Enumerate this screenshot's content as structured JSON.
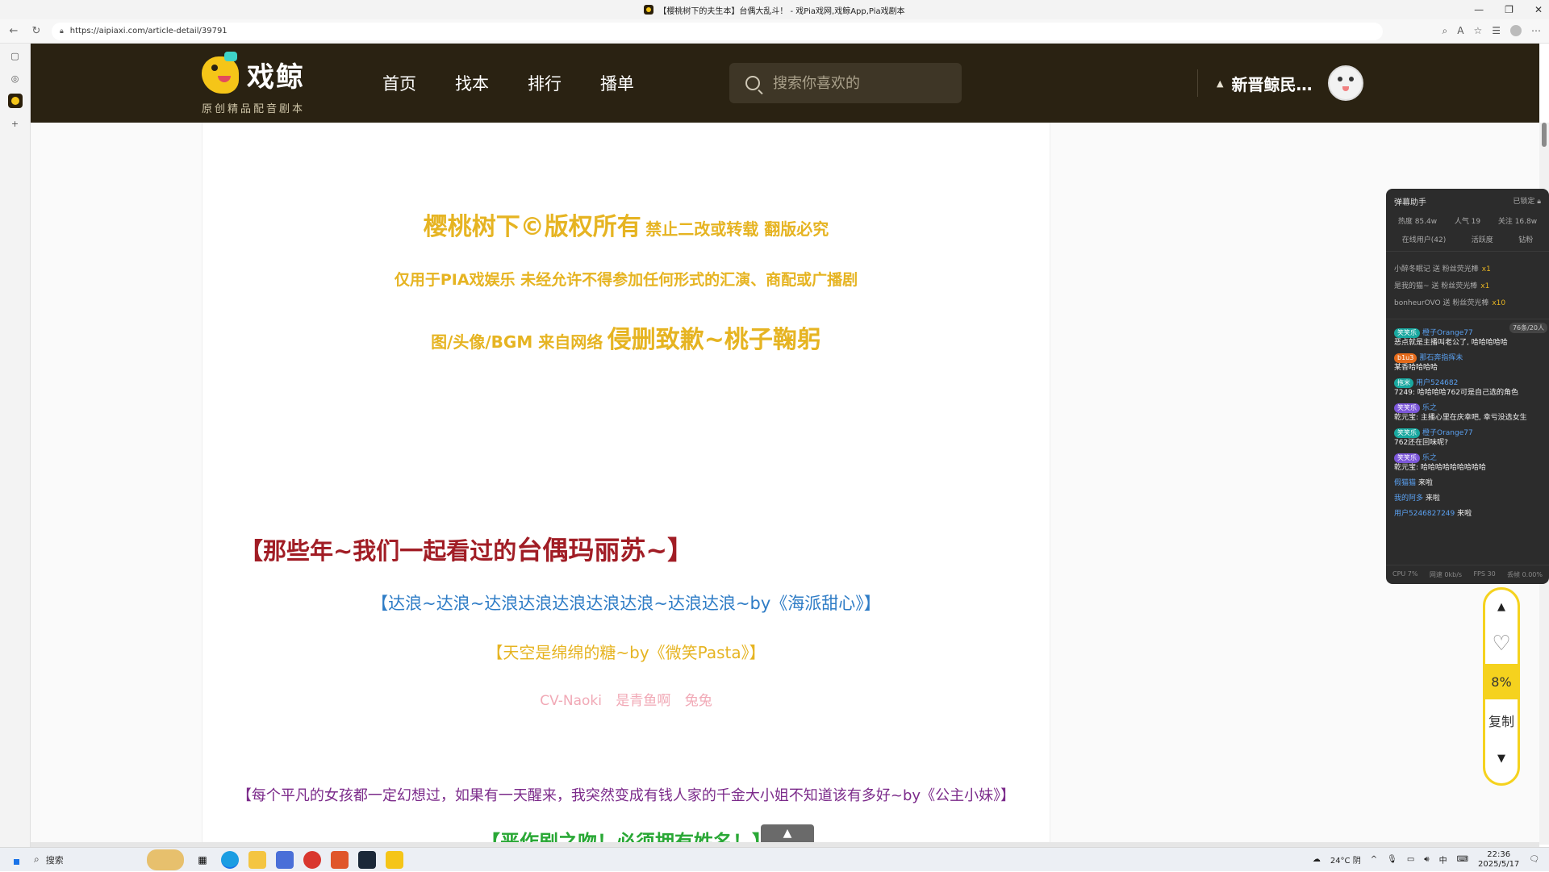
{
  "browser": {
    "title": "【樱桃树下的夫生本】台偶大乱斗！ - 戏Pia戏网,戏鲸App,Pia戏剧本",
    "url": "https://aipiaxi.com/article-detail/39791"
  },
  "site": {
    "logo_text": "戏鲸",
    "logo_sub": "原创精品配音剧本",
    "nav": [
      "首页",
      "找本",
      "排行",
      "播单"
    ],
    "search_placeholder": "搜索你喜欢的",
    "user_name": "新晋鲸民…"
  },
  "article": {
    "line1_big": "樱桃树下©版权所有",
    "line1_small": "禁止二改或转载 翻版必究",
    "line2": "仅用于PIA戏娱乐 未经允许不得参加任何形式的汇演、商配或广播剧",
    "line3_small": "图/头像/BGM 来自网络",
    "line3_big": "侵删致歉~桃子鞠躬",
    "heading_a": "【那些年~我们一起看过的",
    "heading_b": "台偶玛丽苏~】",
    "blue_line": "【达浪~达浪~达浪达浪达浪达浪达浪~达浪达浪~by《海派甜心》】",
    "gold_line": "【天空是绵绵的糖~by《微笑Pasta》】",
    "cv_names": [
      "CV-Naoki",
      "是青鱼啊",
      "兔兔"
    ],
    "purple_line": "【每个平凡的女孩都一定幻想过，如果有一天醒来，我突然变成有钱人家的千金大小姐不知道该有多好~by《公主小妹》】",
    "green_line": "【恶作剧之吻！必须拥有姓名！】"
  },
  "danmu": {
    "title": "弹幕助手",
    "lock_label": "已锁定",
    "stats": [
      "热度 85.4w",
      "人气 19",
      "关注 16.8w"
    ],
    "subtabs": [
      "在线用户(42)",
      "活跃度",
      "钻粉"
    ],
    "gifts": [
      {
        "user": "小醉冬眠记",
        "action": "送 粉丝荧光棒",
        "count": "x1"
      },
      {
        "user": "是我的猫~",
        "action": "送 粉丝荧光棒",
        "count": "x1"
      },
      {
        "user": "bonheurOVO",
        "action": "送 粉丝荧光棒",
        "count": "x10"
      }
    ],
    "count_pill": "76条/20人",
    "messages": [
      {
        "badge": "笑笑乐",
        "user": "橙子Orange77",
        "text": "恶点就是主播叫老公了, 哈哈哈哈哈"
      },
      {
        "badge": "b1u3",
        "user": "那石奔指挥未",
        "text": "某香哈哈哈哈"
      },
      {
        "badge": "拖米",
        "user": "用户524682",
        "text": "7249: 哈哈哈哈762可是自己选的角色"
      },
      {
        "badge": "笑笑乐",
        "user": "乐之",
        "text": "乾元宝: 主播心里在庆幸吧, 幸亏没选女生"
      },
      {
        "badge": "笑笑乐",
        "user": "橙子Orange77",
        "text": "762还在回味呢?"
      },
      {
        "badge": "笑笑乐",
        "user": "乐之",
        "text": "乾元宝: 哈哈哈哈哈哈哈哈哈"
      },
      {
        "badge": "",
        "user": "假猫猫",
        "text": "来啦"
      },
      {
        "badge": "",
        "user": "我的阿多",
        "text": "来啦"
      },
      {
        "badge": "",
        "user": "用户5246827249",
        "text": "来啦"
      }
    ],
    "footer": [
      "CPU 7%",
      "网速 0kb/s",
      "FPS 30",
      "丢帧 0.00%"
    ]
  },
  "float_tools": {
    "percent": "8%",
    "copy": "复制"
  },
  "taskbar": {
    "search": "搜索",
    "weather": "24°C 阴",
    "ime": "中",
    "time": "22:36",
    "date": "2025/5/17"
  }
}
